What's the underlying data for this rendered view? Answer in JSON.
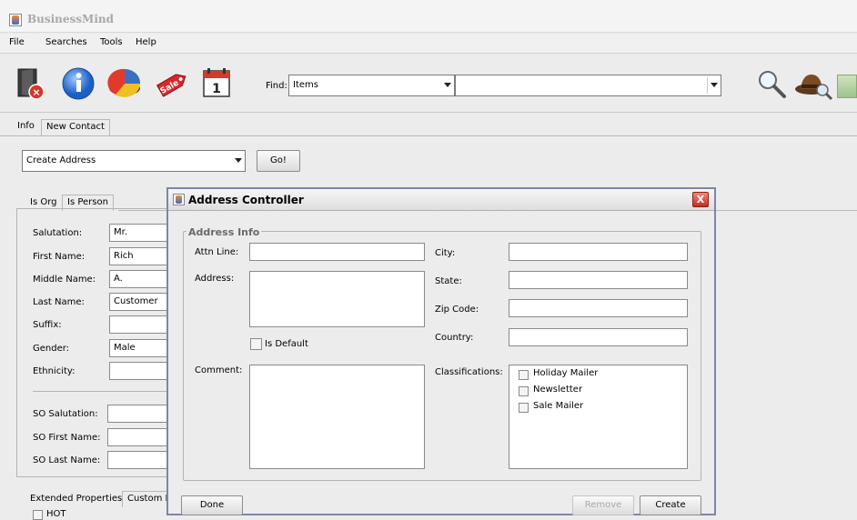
{
  "app": {
    "title": "BusinessMind"
  },
  "menu": [
    "File",
    "Searches",
    "Tools",
    "Help"
  ],
  "toolbar": {
    "icons": [
      "exit-icon",
      "info-icon",
      "pie-chart-icon",
      "sale-tag-icon",
      "calendar-icon",
      "search-icon",
      "detective-hat-icon"
    ],
    "calendar_day": "1",
    "sale_tag_text": "Sale",
    "find_label": "Find:",
    "find_type": "Items",
    "find_query": ""
  },
  "top_tabs": [
    "Info",
    "New Contact"
  ],
  "create_combo": "Create Address",
  "go_label": "Go!",
  "person_tabs": [
    "Is Org",
    "Is Person"
  ],
  "person": {
    "salutation_label": "Salutation:",
    "salutation": "Mr.",
    "first_name_label": "First Name:",
    "first_name": "Rich",
    "middle_name_label": "Middle Name:",
    "middle_name": "A.",
    "last_name_label": "Last Name:",
    "last_name": "Customer",
    "suffix_label": "Suffix:",
    "suffix": "",
    "gender_label": "Gender:",
    "gender": "Male",
    "ethnicity_label": "Ethnicity:",
    "ethnicity": "",
    "so_salutation_label": "SO Salutation:",
    "so_first_name_label": "SO First Name:",
    "so_last_name_label": "SO Last Name:"
  },
  "bottom_tabs": [
    "Extended Properties",
    "Custom F"
  ],
  "bottom_row_label": "HOT",
  "dialog": {
    "title": "Address Controller",
    "close_symbol": "X",
    "legend": "Address Info",
    "attn_label": "Attn Line:",
    "attn": "",
    "address_label": "Address:",
    "address": "",
    "is_default_label": "Is Default",
    "comment_label": "Comment:",
    "comment": "",
    "city_label": "City:",
    "city": "",
    "state_label": "State:",
    "state": "",
    "zip_label": "Zip Code:",
    "zip": "",
    "country_label": "Country:",
    "country": "",
    "classifications_label": "Classifications:",
    "classifications": [
      "Holiday Mailer",
      "Newsletter",
      "Sale Mailer"
    ],
    "done": "Done",
    "remove": "Remove",
    "create": "Create"
  }
}
